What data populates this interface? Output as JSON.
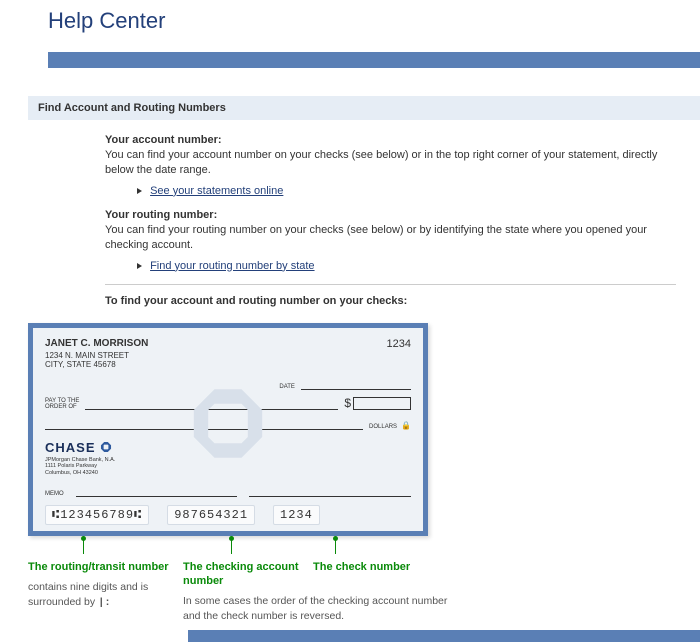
{
  "page": {
    "title": "Help Center"
  },
  "section": {
    "header": "Find Account and Routing Numbers"
  },
  "account": {
    "title": "Your account number:",
    "text": "You can find your account number on your checks (see below) or in the top right corner of your statement, directly below the date range.",
    "link": "See your statements online"
  },
  "routing": {
    "title": "Your routing number:",
    "text": "You can find your routing number on your checks (see below) or by identifying the state where you opened your checking account.",
    "link": "Find your routing number by state"
  },
  "find_line": "To find your account and routing number on your checks:",
  "check": {
    "payer_name": "JANET C. MORRISON",
    "payer_addr1": "1234 N. MAIN STREET",
    "payer_addr2": "CITY, STATE 45678",
    "number": "1234",
    "date_label": "DATE",
    "payto_label1": "PAY TO THE",
    "payto_label2": "ORDER OF",
    "dollar": "$",
    "dollars_label": "DOLLARS",
    "bank_name": "CHASE",
    "bank_sub1": "JPMorgan Chase Bank, N.A.",
    "bank_sub2": "1111 Polaris Parkway",
    "bank_sub3": "Columbus, OH 43240",
    "memo_label": "MEMO",
    "routing": "123456789",
    "account": "987654321",
    "checknum": "1234"
  },
  "ann": {
    "routing_title": "The routing/transit number",
    "routing_text": "contains nine digits and is surrounded by",
    "routing_sym": "|:",
    "account_title": "The checking account number",
    "account_text": "In some cases the order of the checking account number and the check number is reversed.",
    "check_title": "The check number"
  }
}
